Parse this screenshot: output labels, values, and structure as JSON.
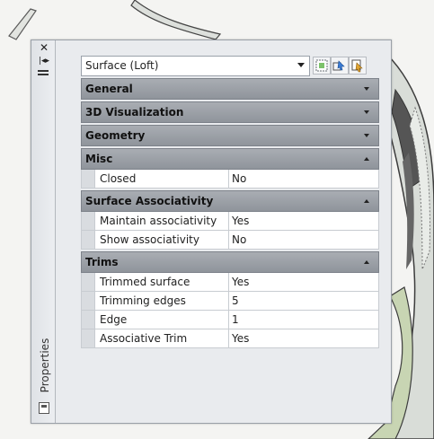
{
  "window": {
    "side_title": "Properties"
  },
  "selector": {
    "value": "Surface (Loft)"
  },
  "toolbar": {
    "icons": [
      "quick-select-icon",
      "select-objects-icon",
      "toggle-pickadd-icon"
    ]
  },
  "categories": {
    "general": {
      "label": "General",
      "state": "collapsed"
    },
    "visualization": {
      "label": "3D Visualization",
      "state": "collapsed"
    },
    "geometry": {
      "label": "Geometry",
      "state": "collapsed"
    },
    "misc": {
      "label": "Misc",
      "state": "expanded",
      "rows": [
        {
          "name": "Closed",
          "value": "No"
        }
      ]
    },
    "associativity": {
      "label": "Surface Associativity",
      "state": "expanded",
      "rows": [
        {
          "name": "Maintain associativity",
          "value": "Yes"
        },
        {
          "name": "Show associativity",
          "value": "No"
        }
      ]
    },
    "trims": {
      "label": "Trims",
      "state": "expanded",
      "rows": [
        {
          "name": "Trimmed surface",
          "value": "Yes"
        },
        {
          "name": "Trimming edges",
          "value": "5"
        },
        {
          "name": "Edge",
          "value": "1"
        },
        {
          "name": "Associative Trim",
          "value": "Yes"
        }
      ]
    }
  }
}
